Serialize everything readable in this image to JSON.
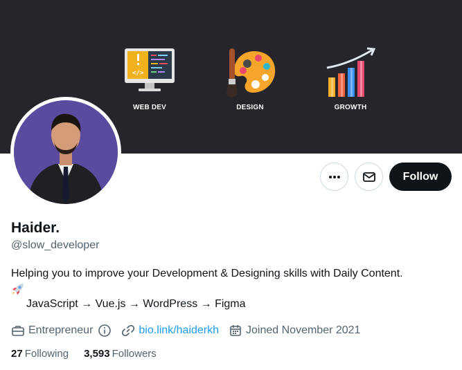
{
  "banner": {
    "features": [
      {
        "label": "WEB DEV",
        "icon": "monitor-code-icon"
      },
      {
        "label": "DESIGN",
        "icon": "palette-icon"
      },
      {
        "label": "GROWTH",
        "icon": "growth-chart-icon"
      }
    ]
  },
  "profile": {
    "name": "Haider.",
    "handle": "@slow_developer",
    "bio_line1": "Helping you to improve your Development & Designing skills with Daily Content.",
    "bio_emoji": "🚀",
    "bio_line3": "JavaScript → Vue.js → WordPress → Figma",
    "category": "Entrepreneur",
    "website": "bio.link/haiderkh",
    "joined": "Joined November 2021"
  },
  "actions": {
    "follow_label": "Follow"
  },
  "stats": {
    "following_count": "27",
    "following_label": "Following",
    "followers_count": "3,593",
    "followers_label": "Followers"
  },
  "colors": {
    "banner_bg": "#25252b",
    "accent": "#1d9bf0",
    "follow_bg": "#0f1419",
    "muted_text": "#536471"
  }
}
